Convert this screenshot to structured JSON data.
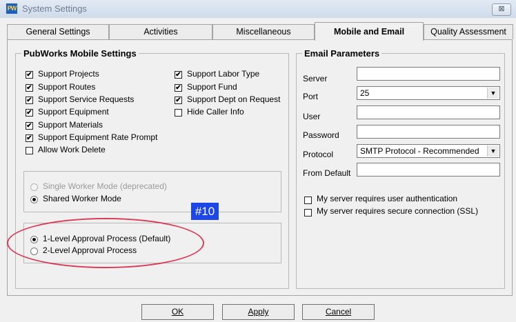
{
  "window": {
    "title": "System Settings",
    "app_icon_text": "PW",
    "close_glyph": "⊠"
  },
  "tabs": [
    {
      "label": "General Settings",
      "active": false
    },
    {
      "label": "Activities",
      "active": false
    },
    {
      "label": "Miscellaneous",
      "active": false
    },
    {
      "label": "Mobile and Email",
      "active": true
    },
    {
      "label": "Quality Assessment",
      "active": false
    }
  ],
  "mobile": {
    "title": "PubWorks Mobile Settings",
    "left_options": [
      {
        "label": "Support Projects",
        "checked": true
      },
      {
        "label": "Support Routes",
        "checked": true
      },
      {
        "label": "Support Service Requests",
        "checked": true
      },
      {
        "label": "Support Equipment",
        "checked": true
      },
      {
        "label": "Support Materials",
        "checked": true
      },
      {
        "label": "Support Equipment Rate Prompt",
        "checked": true
      },
      {
        "label": "Allow Work Delete",
        "checked": false
      }
    ],
    "right_options": [
      {
        "label": "Support Labor Type",
        "checked": true
      },
      {
        "label": "Support Fund",
        "checked": true
      },
      {
        "label": "Support Dept on Request",
        "checked": true
      },
      {
        "label": "Hide Caller Info",
        "checked": false
      }
    ],
    "worker_mode": [
      {
        "label": "Single Worker Mode (deprecated)",
        "selected": false,
        "disabled": true
      },
      {
        "label": "Shared Worker Mode",
        "selected": true,
        "disabled": false
      }
    ],
    "approval": [
      {
        "label": "1-Level Approval Process (Default)",
        "selected": true
      },
      {
        "label": "2-Level Approval Process",
        "selected": false
      }
    ]
  },
  "email": {
    "title": "Email Parameters",
    "server_label": "Server",
    "server_value": "",
    "port_label": "Port",
    "port_value": "25",
    "user_label": "User",
    "user_value": "",
    "password_label": "Password",
    "password_value": "",
    "protocol_label": "Protocol",
    "protocol_value": "SMTP Protocol - Recommended",
    "from_default_label": "From Default",
    "from_default_value": "",
    "auth_label": "My server requires user authentication",
    "auth_checked": false,
    "ssl_label": "My server requires secure connection (SSL)",
    "ssl_checked": false
  },
  "buttons": {
    "ok": "OK",
    "apply": "Apply",
    "cancel": "Cancel"
  },
  "annotation": {
    "badge": "#10",
    "highlight_color": "#d83c57",
    "badge_color": "#1d46e8"
  }
}
